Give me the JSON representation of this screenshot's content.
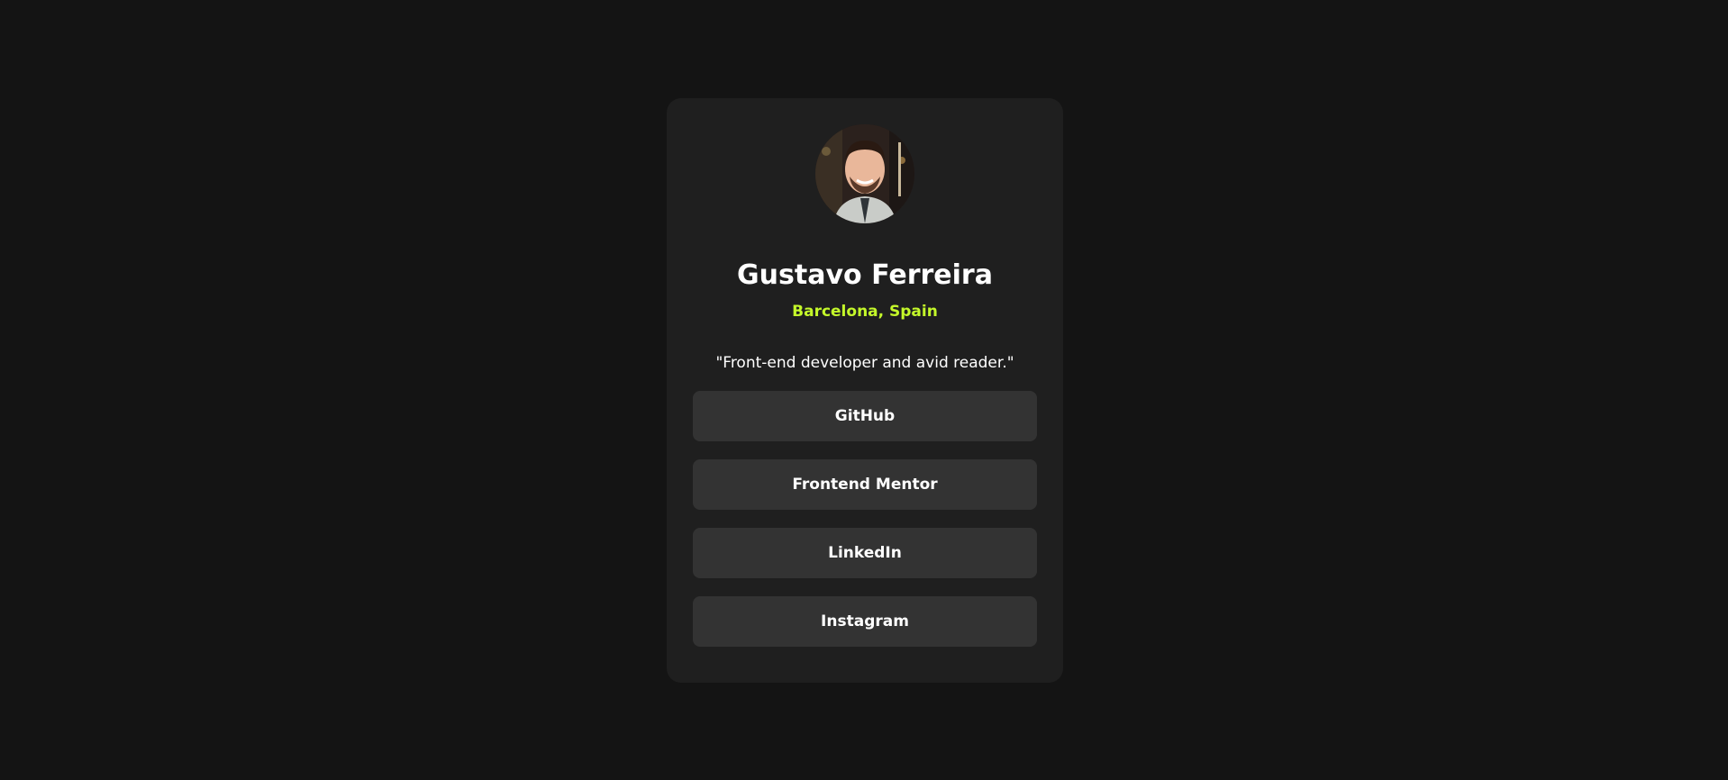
{
  "profile": {
    "name": "Gustavo Ferreira",
    "location": "Barcelona, Spain",
    "bio": "\"Front-end developer and avid reader.\""
  },
  "links": [
    {
      "label": "GitHub"
    },
    {
      "label": "Frontend Mentor"
    },
    {
      "label": "LinkedIn"
    },
    {
      "label": "Instagram"
    }
  ],
  "colors": {
    "background": "#141414",
    "card": "#1f1f1f",
    "button": "#333333",
    "accent": "#c4f82a",
    "text": "#ffffff"
  }
}
